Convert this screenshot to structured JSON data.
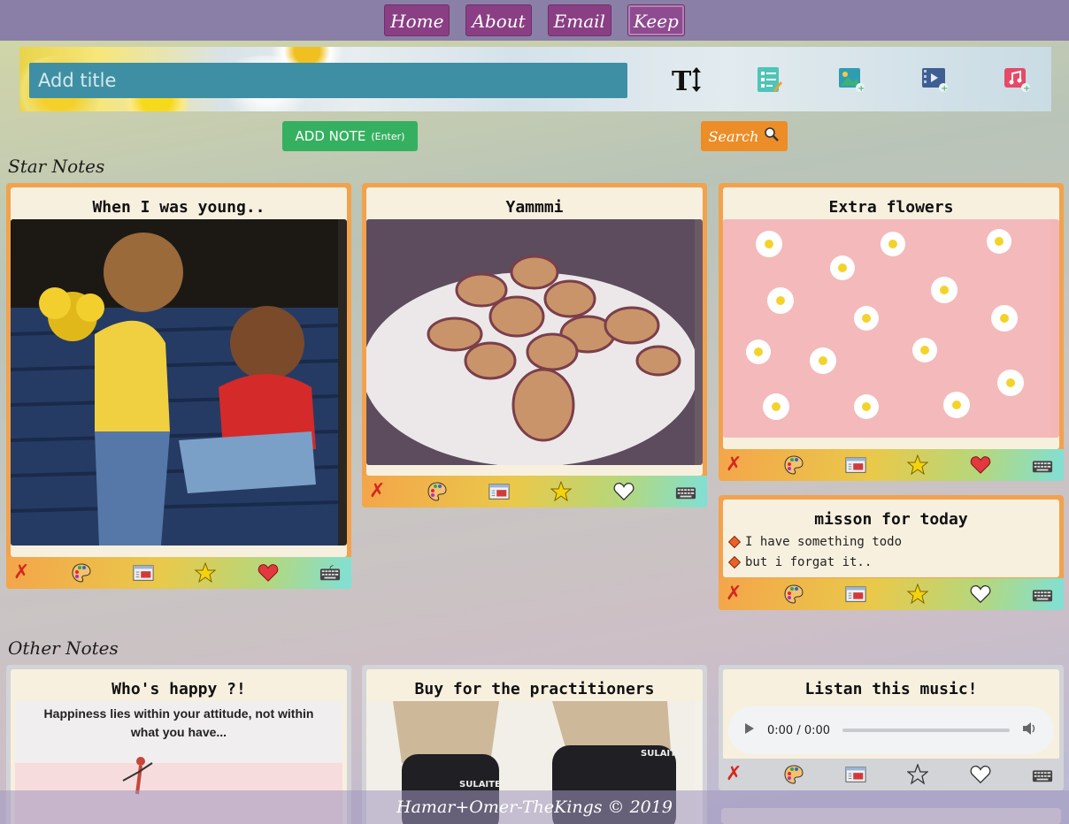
{
  "nav": {
    "items": [
      "Home",
      "About",
      "Email",
      "Keep"
    ],
    "active": "Keep"
  },
  "composer": {
    "title_placeholder": "Add title",
    "tools": [
      "text-size-icon",
      "checklist-icon",
      "add-image-icon",
      "add-video-icon",
      "add-audio-icon"
    ],
    "add_note_label": "ADD NOTE",
    "add_note_hint": "(Enter)",
    "search_label": "Search"
  },
  "sections": {
    "star": "Star Notes",
    "other": "Other Notes"
  },
  "star_notes": [
    {
      "title": "When I was young..",
      "type": "image",
      "liked": true,
      "starred": true
    },
    {
      "title": "Yammmi",
      "type": "image",
      "liked": false,
      "starred": true
    },
    {
      "title": "Extra flowers",
      "type": "image",
      "liked": true,
      "starred": true
    },
    {
      "title": "misson for today",
      "type": "todo",
      "liked": false,
      "starred": true,
      "todos": [
        "I have something todo",
        "but i forgat it.."
      ]
    }
  ],
  "other_notes": [
    {
      "title": "Who's happy ?!",
      "type": "image",
      "image_text": "Happiness lies within your attitude, not within what you have..."
    },
    {
      "title": "Buy for the practitioners",
      "type": "image",
      "brand": "SULAITE"
    },
    {
      "title": "Listan this music!",
      "type": "audio",
      "time": "0:00 / 0:00"
    }
  ],
  "footer": {
    "text": "Hamar+Omer-TheKings © 2019"
  },
  "colors": {
    "accent_nav": "#8a3f84",
    "add_green": "#35b060",
    "search_orange": "#ec8d27",
    "star_border": "#f2a24c",
    "delete_red": "#d6261e"
  }
}
